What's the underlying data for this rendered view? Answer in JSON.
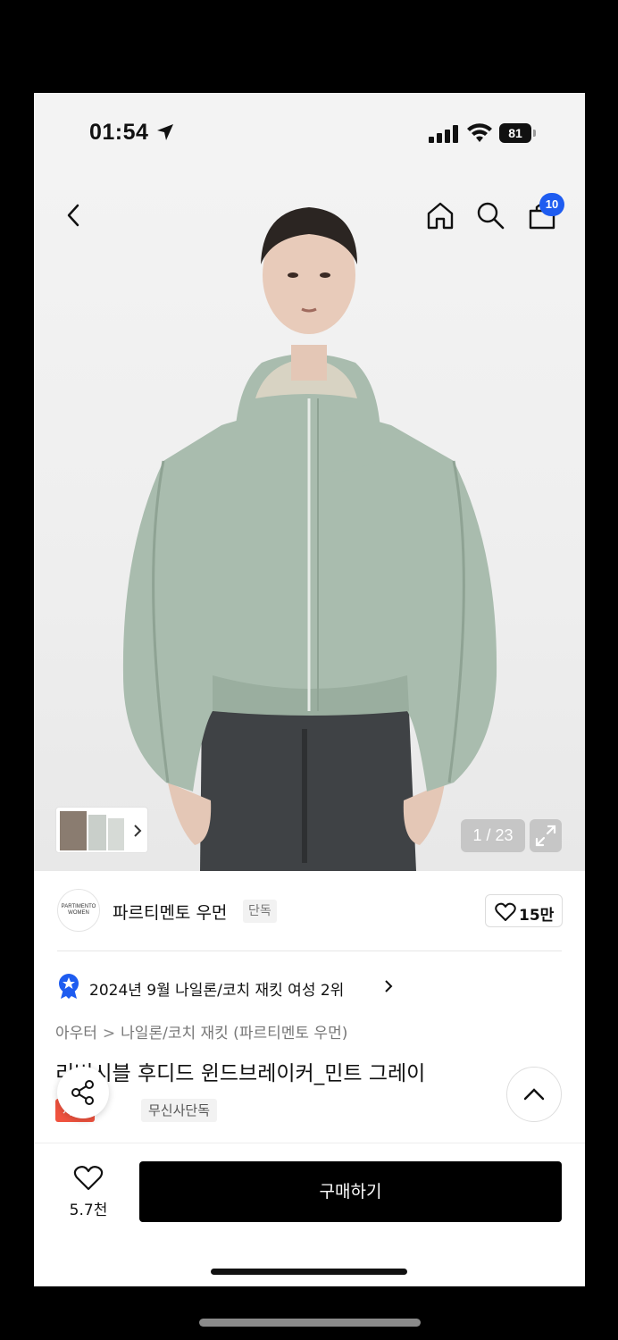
{
  "status_bar": {
    "time": "01:54",
    "battery": "81"
  },
  "nav": {
    "cart_count": "10"
  },
  "gallery": {
    "pager": "1 / 23"
  },
  "brand": {
    "logo_text_1": "PARTIMENTO",
    "logo_text_2": "WOMEN",
    "name": "파르티멘토 우먼",
    "tag": "단독",
    "likes": "15만"
  },
  "ranking": {
    "text": "2024년 9월 나일론/코치 재킷 여성 2위"
  },
  "breadcrumb": {
    "level1": "아우터",
    "separator": ">",
    "level2": "나일론/코치 재킷 (파르티멘토 우먼)"
  },
  "product": {
    "title": "리버시블 후디드 윈드브레이커_민트 그레이",
    "tag_sale": "세일",
    "tag_exclusive": "무신사단독"
  },
  "bottom": {
    "wish_count": "5.7천",
    "buy_label": "구매하기"
  },
  "colors": {
    "accent_blue": "#1e5cf0",
    "sale_red": "#f0533f",
    "jacket": "#a9bcae"
  }
}
